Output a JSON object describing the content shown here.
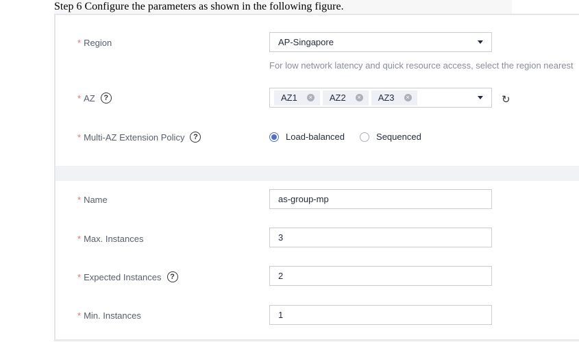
{
  "step_text": "Step 6 Configure the parameters as shown in the following figure.",
  "required_mark": "*",
  "region": {
    "label": "Region",
    "value": "AP-Singapore",
    "hint": "For low network latency and quick resource access, select the region nearest"
  },
  "az": {
    "label": "AZ",
    "tags": [
      "AZ1",
      "AZ2",
      "AZ3"
    ]
  },
  "policy": {
    "label": "Multi-AZ Extension Policy",
    "options": [
      "Load-balanced",
      "Sequenced"
    ],
    "selected": "Load-balanced"
  },
  "name": {
    "label": "Name",
    "value": "as-group-mp"
  },
  "max_instances": {
    "label": "Max. Instances",
    "value": "3"
  },
  "expected_instances": {
    "label": "Expected Instances",
    "value": "2"
  },
  "min_instances": {
    "label": "Min. Instances",
    "value": "1"
  },
  "icons": {
    "help": "?",
    "refresh": "↻",
    "tag_remove": "×"
  },
  "colors": {
    "required": "#f66f6a",
    "radio_selected": "#526ecc",
    "divider": "#f1f2f5"
  }
}
